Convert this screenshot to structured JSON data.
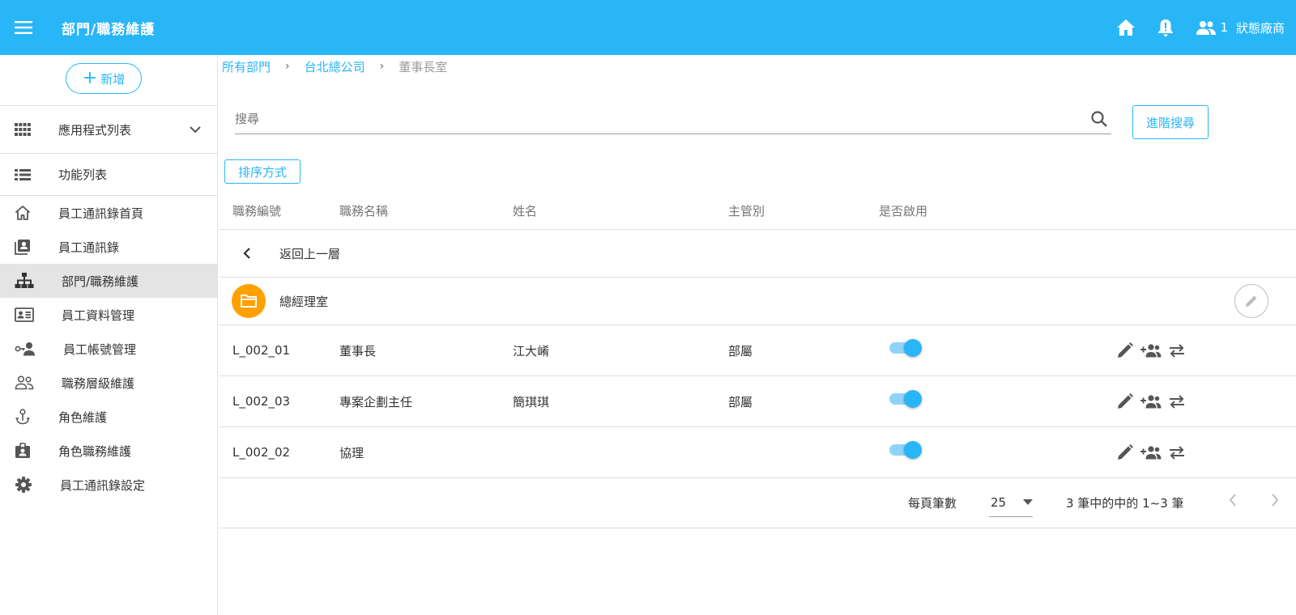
{
  "header": {
    "title": "部門/職務維護",
    "user_count": "1",
    "vendor": "狀態廠商"
  },
  "sidebar": {
    "add_label": "新增",
    "app_list_label": "應用程式列表",
    "nav_head": "功能列表",
    "items": [
      {
        "label": "員工通訊錄首頁",
        "icon": "home-outline-icon"
      },
      {
        "label": "員工通訊錄",
        "icon": "contacts-book-icon"
      },
      {
        "label": "部門/職務維護",
        "icon": "org-chart-icon",
        "active": true
      },
      {
        "label": "員工資料管理",
        "icon": "id-card-icon"
      },
      {
        "label": "員工帳號管理",
        "icon": "account-key-icon"
      },
      {
        "label": "職務層級維護",
        "icon": "people-outline-icon"
      },
      {
        "label": "角色維護",
        "icon": "role-anchor-icon"
      },
      {
        "label": "角色職務維護",
        "icon": "badge-icon"
      },
      {
        "label": "員工通訊錄設定",
        "icon": "gear-icon"
      }
    ]
  },
  "breadcrumb": {
    "items": [
      "所有部門",
      "台北總公司"
    ],
    "current": "董事長室"
  },
  "search": {
    "placeholder": "搜尋",
    "value": "",
    "advanced_label": "進階搜尋"
  },
  "sort_label": "排序方式",
  "table": {
    "headers": [
      "職務編號",
      "職務名稱",
      "姓名",
      "主管別",
      "是否啟用"
    ],
    "back_label": "返回上一層",
    "folder_name": "總經理室",
    "rows": [
      {
        "code": "L_002_01",
        "title": "董事長",
        "name": "江大崤",
        "supervisor": "部屬",
        "enabled": true
      },
      {
        "code": "L_002_03",
        "title": "專案企劃主任",
        "name": "簡琪琪",
        "supervisor": "部屬",
        "enabled": true
      },
      {
        "code": "L_002_02",
        "title": "協理",
        "name": "",
        "supervisor": "",
        "enabled": true
      }
    ]
  },
  "pagination": {
    "per_page_label": "每頁筆數",
    "per_page": "25",
    "range": "3 筆中的中的 1~3 筆"
  },
  "colors": {
    "primary": "#29b6f6",
    "folder": "#ffa000",
    "active_bg": "#e4e4e4"
  }
}
